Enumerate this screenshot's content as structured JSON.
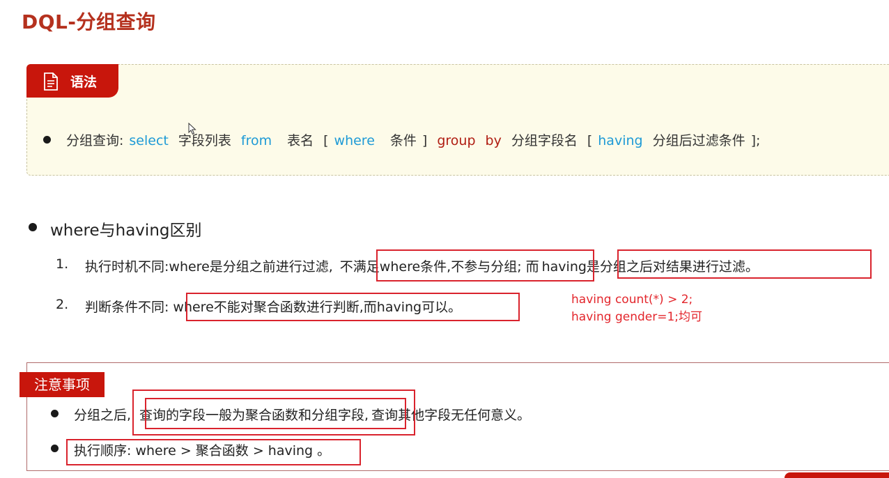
{
  "page": {
    "title": "DQL-分组查询"
  },
  "syntax": {
    "tab_label": "语法",
    "label": "分组查询:",
    "kw_select": "select",
    "field_list": "字段列表",
    "kw_from": "from",
    "table_name": "表名",
    "lb1": "[",
    "kw_where": "where",
    "condition": "条件",
    "rb1": "]",
    "kw_group": "group",
    "kw_by": "by",
    "group_field": "分组字段名",
    "lb2": "[",
    "kw_having": "having",
    "after_filter": "分组后过滤条件",
    "end": "];"
  },
  "differences": {
    "heading": "where与having区别",
    "item1": {
      "num": "1.",
      "part1": "执行时机不同:where是分组之前进行过滤,",
      "part2": "不满足where条件,不参与分组",
      "part3": ";",
      "part4": "而",
      "part5": "having是分组之后对结果进行过滤。"
    },
    "item2": {
      "num": "2.",
      "part1": "判断条件不同:",
      "part2": "where不能对聚合函数进行判断,而having可以。"
    },
    "examples": [
      "having count(*) > 2;",
      "having gender=1;均可"
    ]
  },
  "notes": {
    "tab_label": "注意事项",
    "note1": {
      "part1": "分组之后,",
      "part2": "查询的字段一般为聚合函数和分组字段,",
      "part3": "查询其他字段无任何意义。"
    },
    "note2": "执行顺序: where  >  聚合函数 > having 。"
  },
  "colors": {
    "title": "#b5311e",
    "accent_red": "#c8160c",
    "keyword_blue": "#1e9ad6",
    "keyword_red": "#b01d12",
    "highlight_box": "#d9232d"
  }
}
